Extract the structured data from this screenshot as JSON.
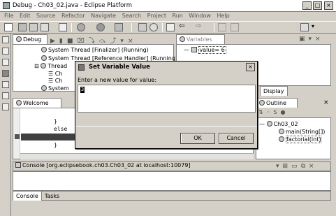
{
  "window": {
    "title": "Debug - Ch03_02.java - Eclipse Platform"
  },
  "menu": [
    "File",
    "Edit",
    "Source",
    "Refactor",
    "Navigate",
    "Search",
    "Project",
    "Run",
    "Window",
    "Help"
  ],
  "debug_view": {
    "tab": "Debug",
    "items": [
      "System Thread [Finalizer] (Running)",
      "System Thread [Reference Handler] (Running)",
      "Thread",
      "Ch",
      "Ch",
      "System"
    ]
  },
  "variables_view": {
    "tab": "Variables",
    "row": "value= 6",
    "display_tab": "Display"
  },
  "editor": {
    "tabs": [
      "Welcome"
    ],
    "lines": [
      "}",
      "else",
      "}"
    ]
  },
  "outline_view": {
    "tab": "Outline",
    "items": [
      "Ch03_02",
      "main(String[])",
      "factorial(int)"
    ]
  },
  "console_view": {
    "title": "Console [org.eclipsebook.ch03.Ch03_02 at localhost:10079]",
    "bottom_tabs": [
      "Console",
      "Tasks"
    ]
  },
  "dialog": {
    "title": "Set Variable Value",
    "prompt": "Enter a new value for value:",
    "input_value": "3",
    "ok_label": "OK",
    "cancel_label": "Cancel"
  }
}
